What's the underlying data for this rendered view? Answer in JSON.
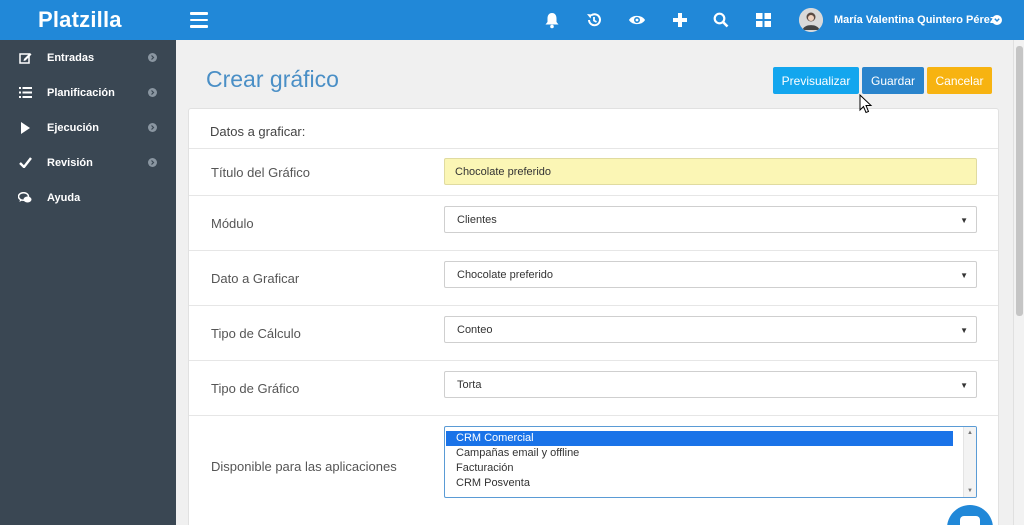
{
  "brand": "Platzilla",
  "sidebar": {
    "items": [
      {
        "label": "Entradas",
        "icon": "edit-icon"
      },
      {
        "label": "Planificación",
        "icon": "list-icon"
      },
      {
        "label": "Ejecución",
        "icon": "play-icon"
      },
      {
        "label": "Revisión",
        "icon": "check-icon"
      },
      {
        "label": "Ayuda",
        "icon": "chat-icon"
      }
    ]
  },
  "topbar": {
    "icons": [
      "menu-icon",
      "bell-icon",
      "history-icon",
      "eye-icon",
      "plus-icon",
      "search-icon",
      "grid-icon"
    ],
    "user_name": "María Valentina Quintero Pérez"
  },
  "page": {
    "title": "Crear gráfico",
    "buttons": {
      "preview": "Previsualizar",
      "save": "Guardar",
      "cancel": "Cancelar"
    }
  },
  "form": {
    "section_title": "Datos a graficar:",
    "fields": {
      "title": {
        "label": "Título del Gráfico",
        "value": "Chocolate preferido"
      },
      "module": {
        "label": "Módulo",
        "value": "Clientes"
      },
      "data": {
        "label": "Dato a Graficar",
        "value": "Chocolate preferido"
      },
      "calc": {
        "label": "Tipo de Cálculo",
        "value": "Conteo"
      },
      "chart_type": {
        "label": "Tipo de Gráfico",
        "value": "Torta"
      },
      "apps": {
        "label": "Disponible para las aplicaciones",
        "options": [
          "CRM Comercial",
          "Campañas email y offline",
          "Facturación",
          "CRM Posventa"
        ],
        "selected": "CRM Comercial"
      }
    }
  },
  "colors": {
    "primary": "#2188d8",
    "sidebar": "#3a4753",
    "preview_button": "#13a6ee",
    "save_button": "#2a84cc",
    "cancel_button": "#f7b311",
    "title_field_bg": "#fbf6b5",
    "page_title": "#4a8fc6"
  }
}
